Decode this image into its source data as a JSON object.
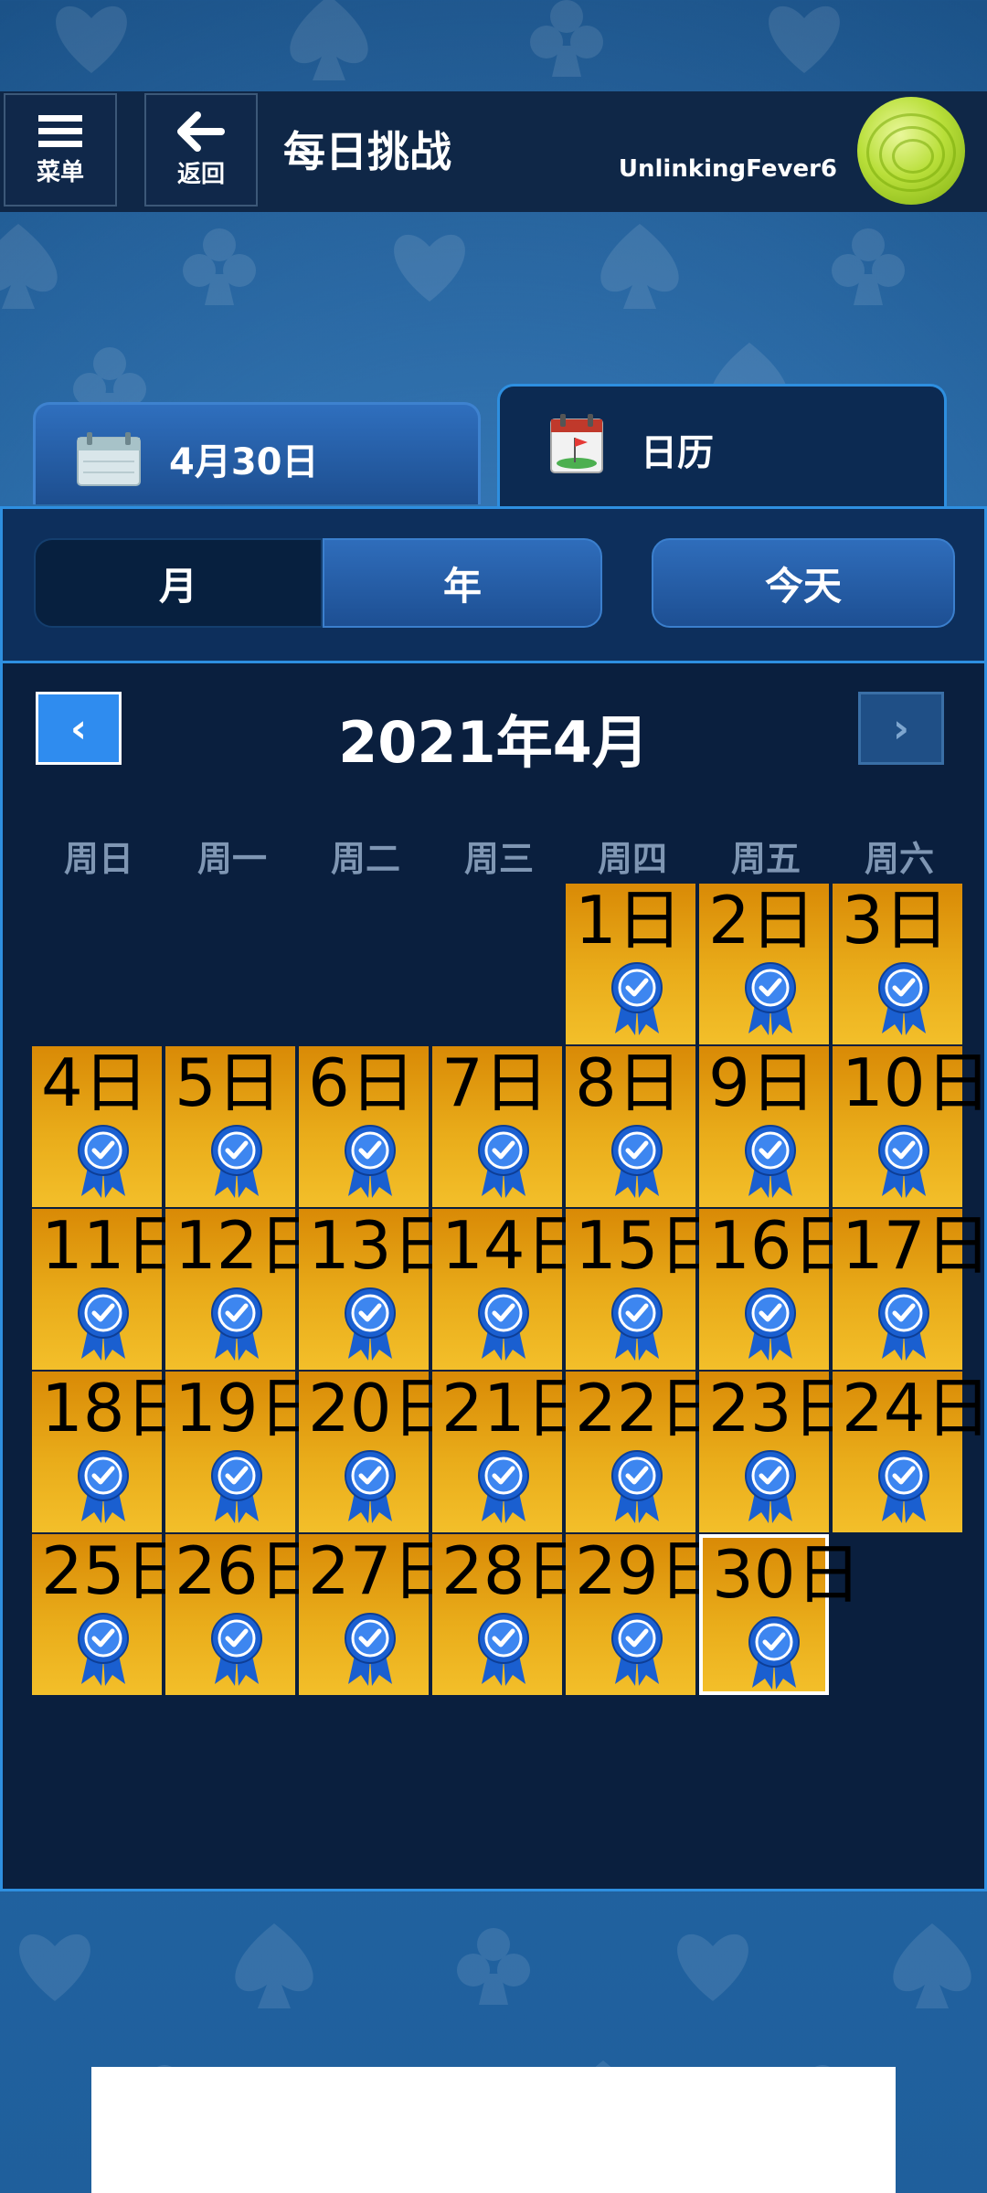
{
  "header": {
    "menu_label": "菜单",
    "back_label": "返回",
    "title": "每日挑战",
    "username": "UnlinkingFever6"
  },
  "tabs": {
    "date_tab": "4月30日",
    "calendar_tab": "日历"
  },
  "segments": {
    "month": "月",
    "year": "年",
    "today": "今天"
  },
  "calendar": {
    "month_title": "2021年4月",
    "prev": "‹",
    "next": "›",
    "weekdays": [
      "周日",
      "周一",
      "周二",
      "周三",
      "周四",
      "周五",
      "周六"
    ],
    "first_weekday_index": 4,
    "day_suffix": "日",
    "days_in_month": 30,
    "selected_day": 30,
    "completed_days": [
      1,
      2,
      3,
      4,
      5,
      6,
      7,
      8,
      9,
      10,
      11,
      12,
      13,
      14,
      15,
      16,
      17,
      18,
      19,
      20,
      21,
      22,
      23,
      24,
      25,
      26,
      27,
      28,
      29,
      30
    ],
    "cell_color": "#e9ac1a",
    "badge_color": "#1a5fd0"
  }
}
